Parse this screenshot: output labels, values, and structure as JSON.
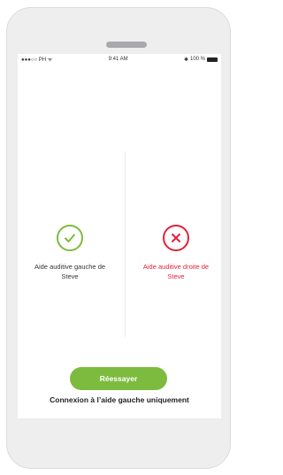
{
  "status_bar": {
    "carrier": "●●●○○ PH ᯤ",
    "time": "9:41 AM",
    "battery": "100 %"
  },
  "left_aid": {
    "label": "Aide auditive gauche de Steve",
    "status_icon": "checkmark-icon",
    "status_color": "#7dbb3f"
  },
  "right_aid": {
    "label": "Aide auditive droite de Steve",
    "status_icon": "x-icon",
    "status_color": "#e0223c"
  },
  "actions": {
    "retry_label": "Réessayer",
    "connect_left_only_label": "Connexion à l’aide gauche uniquement"
  },
  "colors": {
    "accent": "#7dbb3f",
    "error": "#e0223c",
    "device_frame": "#eeeeef"
  }
}
